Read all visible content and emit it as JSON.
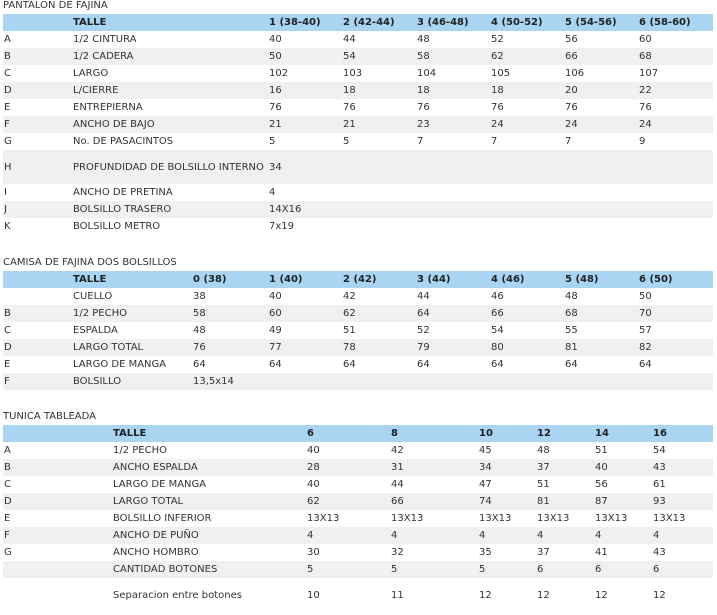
{
  "tables": [
    {
      "title": "PANTALON DE FAJINA",
      "header": [
        "",
        "TALLE",
        "1 (38-40)",
        "2 (42-44)",
        "3 (46-48)",
        "4 (50-52)",
        "5 (54-56)",
        "6 (58-60)"
      ],
      "rows": [
        [
          "A",
          "1/2 CINTURA",
          "40",
          "44",
          "48",
          "52",
          "56",
          "60"
        ],
        [
          "B",
          "1/2 CADERA",
          "50",
          "54",
          "58",
          "62",
          "66",
          "68"
        ],
        [
          "C",
          "LARGO",
          "102",
          "103",
          "104",
          "105",
          "106",
          "107"
        ],
        [
          "D",
          "L/CIERRE",
          "16",
          "18",
          "18",
          "18",
          "20",
          "22"
        ],
        [
          "E",
          "ENTREPIERNA",
          "76",
          "76",
          "76",
          "76",
          "76",
          "76"
        ],
        [
          "F",
          "ANCHO DE BAJO",
          "21",
          "21",
          "23",
          "24",
          "24",
          "24"
        ],
        [
          "G",
          "No. DE PASACINTOS",
          "5",
          "5",
          "7",
          "7",
          "7",
          "9"
        ],
        [
          "H",
          "PROFUNDIDAD DE BOLSILLO INTERNO",
          "34",
          "",
          "",
          "",
          "",
          ""
        ],
        [
          "I",
          "ANCHO DE PRETINA",
          "4",
          "",
          "",
          "",
          "",
          ""
        ],
        [
          "J",
          "BOLSILLO TRASERO",
          "14X16",
          "",
          "",
          "",
          "",
          ""
        ],
        [
          "K",
          "BOLSILLO METRO",
          "7x19",
          "",
          "",
          "",
          "",
          ""
        ]
      ]
    },
    {
      "title": "CAMISA DE FAJINA DOS BOLSILLOS",
      "header": [
        "",
        "TALLE",
        "0 (38)",
        "1 (40)",
        "2 (42)",
        "3 (44)",
        "4 (46)",
        "5 (48)",
        "6 (50)"
      ],
      "rows": [
        [
          "",
          "CUELLO",
          "38",
          "40",
          "42",
          "44",
          "46",
          "48",
          "50"
        ],
        [
          "B",
          "1/2 PECHO",
          "58",
          "60",
          "62",
          "64",
          "66",
          "68",
          "70"
        ],
        [
          "C",
          "ESPALDA",
          "48",
          "49",
          "51",
          "52",
          "54",
          "55",
          "57"
        ],
        [
          "D",
          "LARGO TOTAL",
          "76",
          "77",
          "78",
          "79",
          "80",
          "81",
          "82"
        ],
        [
          "E",
          "LARGO DE MANGA",
          "64",
          "64",
          "64",
          "64",
          "64",
          "64",
          "64"
        ],
        [
          "F",
          "BOLSILLO",
          "13,5x14",
          "",
          "",
          "",
          "",
          "",
          ""
        ]
      ]
    },
    {
      "title": "TUNICA TABLEADA",
      "header": [
        "",
        "TALLE",
        "6",
        "8",
        "10",
        "12",
        "14",
        "16"
      ],
      "rows": [
        [
          "A",
          "1/2 PECHO",
          "40",
          "42",
          "45",
          "48",
          "51",
          "54"
        ],
        [
          "B",
          "ANCHO ESPALDA",
          "28",
          "31",
          "34",
          "37",
          "40",
          "43"
        ],
        [
          "C",
          "LARGO DE MANGA",
          "40",
          "44",
          "47",
          "51",
          "56",
          "61"
        ],
        [
          "D",
          "LARGO TOTAL",
          "62",
          "66",
          "74",
          "81",
          "87",
          "93"
        ],
        [
          "E",
          "BOLSILLO INFERIOR",
          "13X13",
          "13X13",
          "13X13",
          "13X13",
          "13X13",
          "13X13"
        ],
        [
          "F",
          "ANCHO DE PUÑO",
          "4",
          "4",
          "4",
          "4",
          "4",
          "4"
        ],
        [
          "G",
          "ANCHO HOMBRO",
          "30",
          "32",
          "35",
          "37",
          "41",
          "43"
        ],
        [
          "",
          "CANTIDAD BOTONES",
          "5",
          "5",
          "5",
          "6",
          "6",
          "6"
        ],
        [
          "",
          "Separacion entre botones",
          "10",
          "11",
          "12",
          "12",
          "12",
          "12"
        ]
      ]
    }
  ]
}
